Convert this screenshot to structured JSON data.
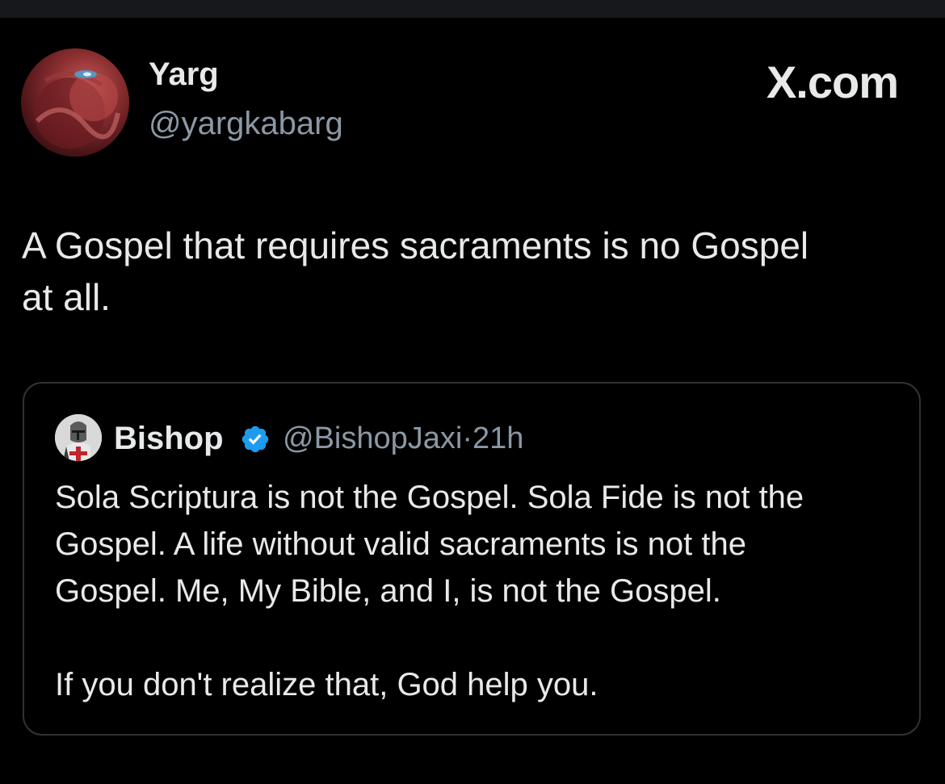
{
  "theme": {
    "background": "#000000",
    "text_primary": "#e7e9ea",
    "text_secondary": "#8b98a5",
    "border": "#2f3336",
    "verified_blue": "#1d9bf0"
  },
  "post": {
    "author_name": "Yarg",
    "author_handle": "@yargkabarg",
    "brand": "X.com",
    "text_line1": "A Gospel that requires sacraments is no Gospel",
    "text_line2": "at all."
  },
  "quoted_post": {
    "author_name": "Bishop",
    "verified": true,
    "handle": "@BishopJaxi",
    "separator": "·",
    "time": "21h",
    "lines": [
      "Sola Scriptura is not the Gospel. Sola Fide is not the",
      "Gospel. A life without valid sacraments is not the",
      "Gospel. Me, My Bible, and I, is not the Gospel."
    ],
    "closing": "If you don't realize that, God help you."
  },
  "icons": {
    "author_avatar": "avatar-image",
    "quote_avatar": "knight-avatar-image",
    "verified": "verified-badge-icon"
  }
}
